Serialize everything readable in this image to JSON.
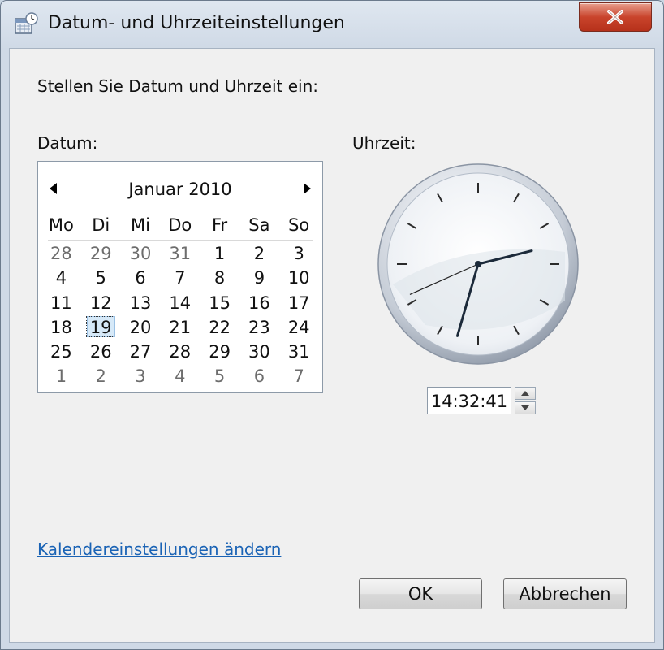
{
  "window": {
    "title": "Datum- und Uhrzeiteinstellungen",
    "close_label": "✕"
  },
  "instruction": "Stellen Sie Datum und Uhrzeit ein:",
  "date_label": "Datum:",
  "time_label": "Uhrzeit:",
  "calendar": {
    "month_title": "Januar 2010",
    "weekday_headers": [
      "Mo",
      "Di",
      "Mi",
      "Do",
      "Fr",
      "Sa",
      "So"
    ],
    "weeks": [
      [
        {
          "d": "28",
          "other": true
        },
        {
          "d": "29",
          "other": true
        },
        {
          "d": "30",
          "other": true
        },
        {
          "d": "31",
          "other": true
        },
        {
          "d": "1"
        },
        {
          "d": "2"
        },
        {
          "d": "3"
        }
      ],
      [
        {
          "d": "4"
        },
        {
          "d": "5"
        },
        {
          "d": "6"
        },
        {
          "d": "7"
        },
        {
          "d": "8"
        },
        {
          "d": "9"
        },
        {
          "d": "10"
        }
      ],
      [
        {
          "d": "11"
        },
        {
          "d": "12"
        },
        {
          "d": "13"
        },
        {
          "d": "14"
        },
        {
          "d": "15"
        },
        {
          "d": "16"
        },
        {
          "d": "17"
        }
      ],
      [
        {
          "d": "18"
        },
        {
          "d": "19",
          "selected": true
        },
        {
          "d": "20"
        },
        {
          "d": "21"
        },
        {
          "d": "22"
        },
        {
          "d": "23"
        },
        {
          "d": "24"
        }
      ],
      [
        {
          "d": "25"
        },
        {
          "d": "26"
        },
        {
          "d": "27"
        },
        {
          "d": "28"
        },
        {
          "d": "29"
        },
        {
          "d": "30"
        },
        {
          "d": "31"
        }
      ],
      [
        {
          "d": "1",
          "other": true
        },
        {
          "d": "2",
          "other": true
        },
        {
          "d": "3",
          "other": true
        },
        {
          "d": "4",
          "other": true
        },
        {
          "d": "5",
          "other": true
        },
        {
          "d": "6",
          "other": true
        },
        {
          "d": "7",
          "other": true
        }
      ]
    ]
  },
  "time": {
    "value": "14:32:41",
    "hours": 14,
    "minutes": 32,
    "seconds": 41
  },
  "link_label": "Kalendereinstellungen ändern",
  "buttons": {
    "ok": "OK",
    "cancel": "Abbrechen"
  },
  "colors": {
    "link": "#1a63b5",
    "close_button": "#c9442c",
    "selection": "#d6e9f8"
  }
}
